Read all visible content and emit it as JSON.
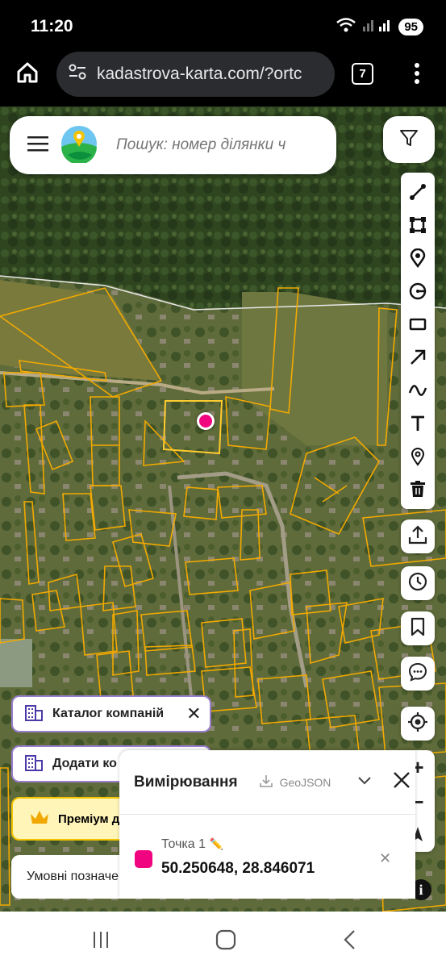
{
  "status": {
    "time": "11:20",
    "battery": "95"
  },
  "browser": {
    "url": "kadastrova-karta.com/?ortc",
    "tab_count": "7"
  },
  "search": {
    "placeholder": "Пошук: номер ділянки ч"
  },
  "companies": {
    "catalog_label": "Каталог компаній",
    "add_label": "Додати ко"
  },
  "premium": {
    "label": "Преміум д"
  },
  "legend": {
    "label": "Умовні позначе"
  },
  "measure": {
    "title": "Вимірювання",
    "geojson_label": "GeoJSON",
    "point_name": "Точка 1",
    "point_color": "#f0047f",
    "coordinates": "50.250648, 28.846071"
  },
  "tools": [
    "line-icon",
    "polygon-icon",
    "marker-icon",
    "circle-icon",
    "rectangle-icon",
    "arrow-icon",
    "freehand-icon",
    "text-icon",
    "location-pin-icon",
    "trash-icon"
  ],
  "colors": {
    "parcel_outline": "#f2a900",
    "marker": "#f0047f"
  }
}
